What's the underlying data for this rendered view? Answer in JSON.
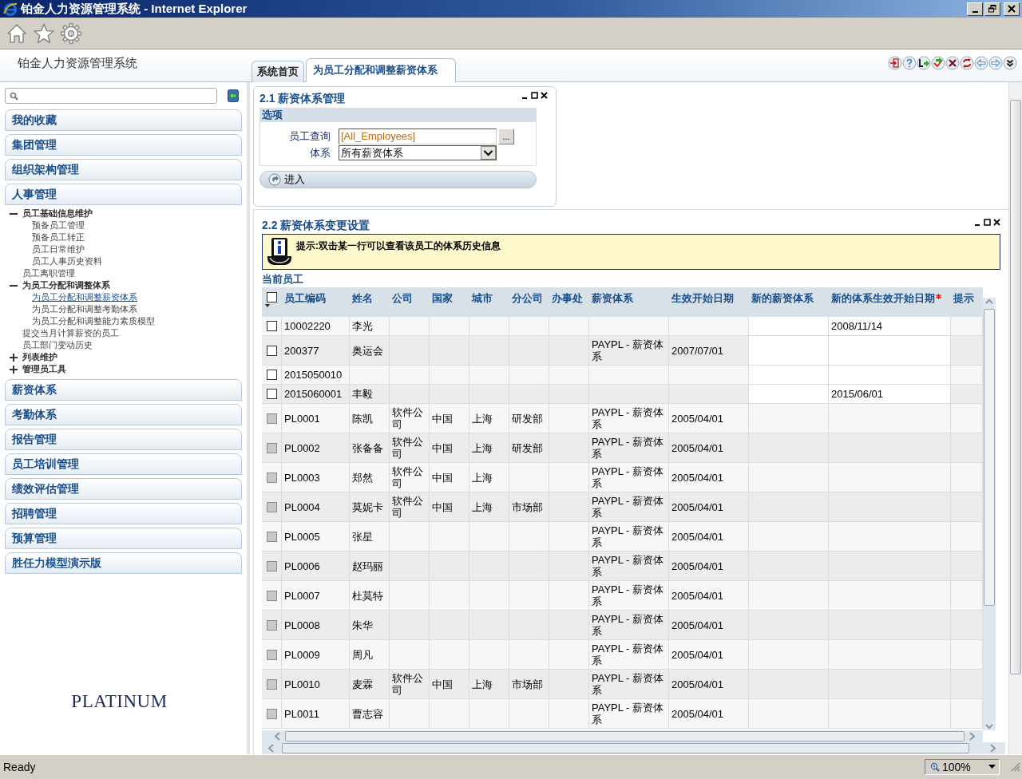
{
  "window": {
    "title": "铂金人力资源管理系统 - Internet Explorer"
  },
  "app": {
    "title": "铂金人力资源管理系统"
  },
  "tabs": [
    {
      "label": "系统首页",
      "selected": false
    },
    {
      "label": "为员工分配和调整薪资体系",
      "selected": true
    }
  ],
  "sidebar": {
    "sections": [
      {
        "label": "我的收藏"
      },
      {
        "label": "集团管理"
      },
      {
        "label": "组织架构管理"
      },
      {
        "label": "人事管理",
        "tree": [
          {
            "kind": "folder",
            "label": "员工基础信息维护",
            "expanded": true,
            "children": [
              {
                "kind": "link",
                "label": "预备员工管理",
                "selected": false
              },
              {
                "kind": "link",
                "label": "预备员工转正",
                "selected": false
              },
              {
                "kind": "link",
                "label": "员工日常维护",
                "selected": false
              },
              {
                "kind": "link",
                "label": "员工人事历史资料",
                "selected": false
              }
            ]
          },
          {
            "kind": "link",
            "label": "员工离职管理",
            "selected": false
          },
          {
            "kind": "folder",
            "label": "为员工分配和调整体系",
            "expanded": true,
            "children": [
              {
                "kind": "link",
                "label": "为员工分配和调整薪资体系",
                "selected": true
              },
              {
                "kind": "link",
                "label": "为员工分配和调整考勤体系",
                "selected": false
              },
              {
                "kind": "link",
                "label": "为员工分配和调整能力素质模型",
                "selected": false
              }
            ]
          },
          {
            "kind": "link",
            "label": "提交当月计算薪资的员工",
            "selected": false
          },
          {
            "kind": "link",
            "label": "员工部门变动历史",
            "selected": false
          },
          {
            "kind": "folder",
            "label": "列表维护",
            "expanded": false
          },
          {
            "kind": "folder",
            "label": "管理员工具",
            "expanded": false
          }
        ]
      },
      {
        "label": "薪资体系"
      },
      {
        "label": "考勤体系"
      },
      {
        "label": "报告管理"
      },
      {
        "label": "员工培训管理"
      },
      {
        "label": "绩效评估管理"
      },
      {
        "label": "招聘管理"
      },
      {
        "label": "预算管理"
      },
      {
        "label": "胜任力模型演示版"
      }
    ],
    "logo": "PLATINUM"
  },
  "panel_1": {
    "title": "2.1 薪资体系管理",
    "section": "选项",
    "fields": [
      {
        "kind": "lookup",
        "label": "员工查询",
        "value": "[All_Employees]",
        "button": "..."
      },
      {
        "kind": "select",
        "label": "体系",
        "value": "所有薪资体系"
      }
    ],
    "action": "进入"
  },
  "panel_2": {
    "title": "2.2 薪资体系变更设置",
    "hint": "提示:双击某一行可以查看该员工的体系历史信息",
    "group": "当前员工",
    "table": {
      "header_checked": false,
      "columns": [
        {
          "label": "员工编码"
        },
        {
          "label": "姓名"
        },
        {
          "label": "公司"
        },
        {
          "label": "国家"
        },
        {
          "label": "城市"
        },
        {
          "label": "分公司"
        },
        {
          "label": "办事处"
        },
        {
          "label": "薪资体系"
        },
        {
          "label": "生效开始日期"
        },
        {
          "label": "新的薪资体系"
        },
        {
          "label": "新的体系生效开始日期",
          "required": true
        },
        {
          "label": "提示"
        }
      ],
      "rows": [
        {
          "checked": false,
          "disabled": false,
          "id": "10002220",
          "name": "李光",
          "new_start": "2008/11/14"
        },
        {
          "checked": false,
          "disabled": false,
          "id": "200377",
          "name": "奥运会",
          "system": "PAYPL - 薪资体系",
          "start": "2007/07/01"
        },
        {
          "checked": false,
          "disabled": false,
          "id": "2015050010"
        },
        {
          "checked": false,
          "disabled": false,
          "id": "2015060001",
          "name": "丰毅",
          "new_start": "2015/06/01"
        },
        {
          "checked": false,
          "disabled": true,
          "id": "PL0001",
          "name": "陈凯",
          "company": "软件公司",
          "country": "中国",
          "city": "上海",
          "branch": "研发部",
          "system": "PAYPL - 薪资体系",
          "start": "2005/04/01"
        },
        {
          "checked": false,
          "disabled": true,
          "id": "PL0002",
          "name": "张备备",
          "company": "软件公司",
          "country": "中国",
          "city": "上海",
          "branch": "研发部",
          "system": "PAYPL - 薪资体系",
          "start": "2005/04/01"
        },
        {
          "checked": false,
          "disabled": true,
          "id": "PL0003",
          "name": "郑然",
          "company": "软件公司",
          "country": "中国",
          "city": "上海",
          "system": "PAYPL - 薪资体系",
          "start": "2005/04/01"
        },
        {
          "checked": false,
          "disabled": true,
          "id": "PL0004",
          "name": "莫妮卡",
          "company": "软件公司",
          "country": "中国",
          "city": "上海",
          "branch": "市场部",
          "system": "PAYPL - 薪资体系",
          "start": "2005/04/01"
        },
        {
          "checked": false,
          "disabled": true,
          "id": "PL0005",
          "name": "张星",
          "system": "PAYPL - 薪资体系",
          "start": "2005/04/01"
        },
        {
          "checked": false,
          "disabled": true,
          "id": "PL0006",
          "name": "赵玛丽",
          "system": "PAYPL - 薪资体系",
          "start": "2005/04/01"
        },
        {
          "checked": false,
          "disabled": true,
          "id": "PL0007",
          "name": "杜莫特",
          "system": "PAYPL - 薪资体系",
          "start": "2005/04/01"
        },
        {
          "checked": false,
          "disabled": true,
          "id": "PL0008",
          "name": "朱华",
          "system": "PAYPL - 薪资体系",
          "start": "2005/04/01"
        },
        {
          "checked": false,
          "disabled": true,
          "id": "PL0009",
          "name": "周凡",
          "system": "PAYPL - 薪资体系",
          "start": "2005/04/01"
        },
        {
          "checked": false,
          "disabled": true,
          "id": "PL0010",
          "name": "麦霖",
          "company": "软件公司",
          "country": "中国",
          "city": "上海",
          "branch": "市场部",
          "system": "PAYPL - 薪资体系",
          "start": "2005/04/01"
        },
        {
          "checked": false,
          "disabled": true,
          "id": "PL0011",
          "name": "曹志容",
          "system": "PAYPL - 薪资体系",
          "start": "2005/04/01"
        }
      ]
    }
  },
  "status_bar": {
    "text": "Ready",
    "zoom": "100%"
  }
}
